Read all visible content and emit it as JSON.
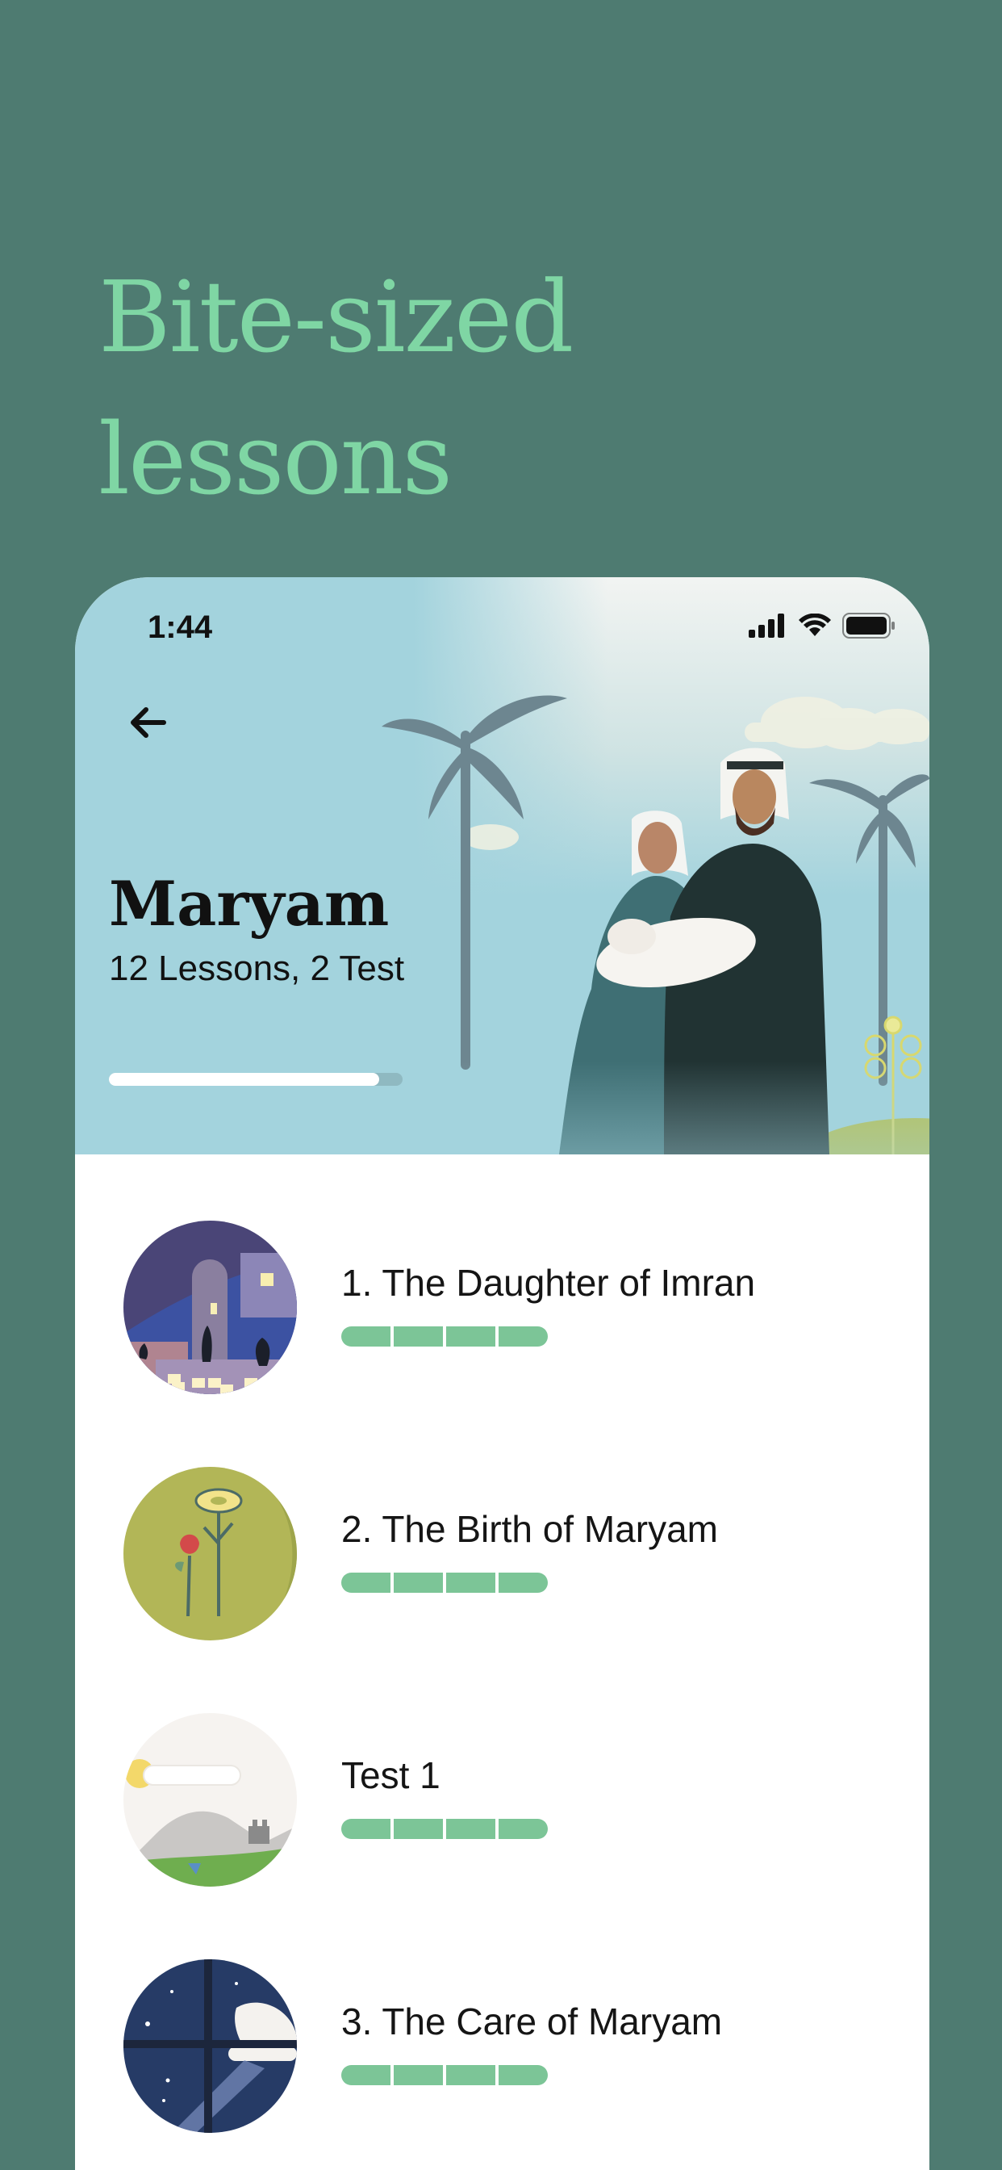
{
  "marketing": {
    "headline_line1": "Bite-sized",
    "headline_line2": "lessons"
  },
  "status_bar": {
    "time": "1:44",
    "icons": [
      "cellular-signal-icon",
      "wifi-icon",
      "battery-icon"
    ]
  },
  "course": {
    "title": "Maryam",
    "subtitle": "12 Lessons, 2 Test",
    "progress_fraction": 0.92,
    "back_icon": "arrow-left-icon"
  },
  "lessons": [
    {
      "title": "1. The Daughter of Imran",
      "segments": 4,
      "thumbnail": "night-town-illustration"
    },
    {
      "title": "2. The Birth of Maryam",
      "segments": 4,
      "thumbnail": "flower-illustration"
    },
    {
      "title": "Test 1",
      "segments": 4,
      "thumbnail": "mountain-landscape-illustration"
    },
    {
      "title": "3. The Care of Maryam",
      "segments": 4,
      "thumbnail": "night-window-illustration"
    }
  ],
  "colors": {
    "background": "#4e7b71",
    "headline": "#7fd6a4",
    "hero_bg": "#a3d3dd",
    "segment": "#7cc597"
  }
}
